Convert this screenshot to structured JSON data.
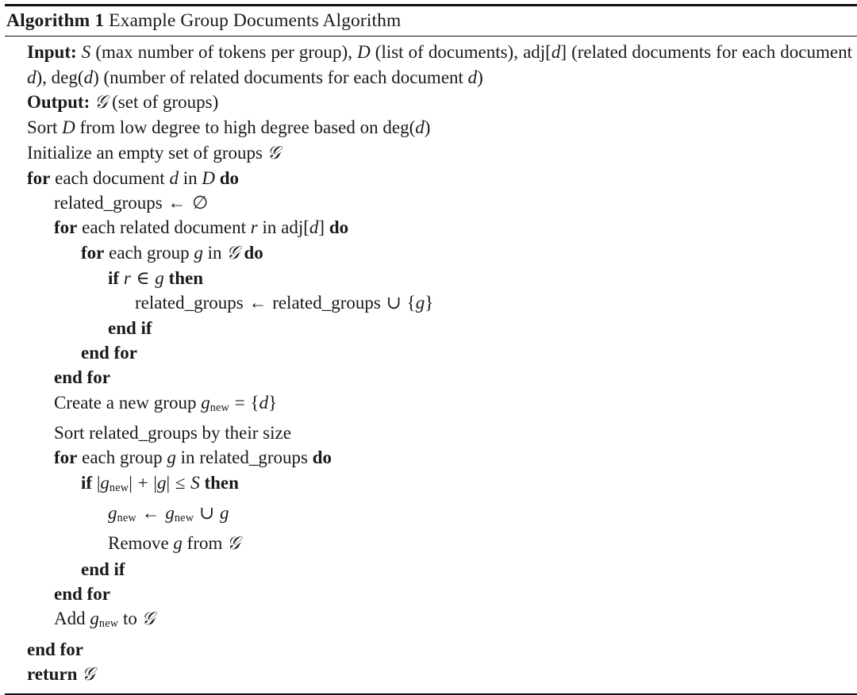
{
  "document": {
    "type": "algorithm-float",
    "caption_keyword": "Algorithm",
    "caption_number": "1",
    "caption_title": "Example Group Documents Algorithm",
    "rules": {
      "top": "thick",
      "under_caption": "thin",
      "bottom": "thin"
    },
    "colors": {
      "text": "#1a1a1a",
      "rule": "#111111",
      "background": "#ffffff"
    }
  },
  "lines": [
    {
      "id": "input",
      "indent": 0,
      "label": "Input:",
      "text": "S (max number of tokens per group), D (list of documents), adj[d] (related documents for each document d), deg(d) (number of related documents for each document d)"
    },
    {
      "id": "output",
      "indent": 0,
      "label": "Output:",
      "text": "G (set of groups)"
    },
    {
      "id": "sort-d",
      "indent": 0,
      "text": "Sort D from low degree to high degree based on deg(d)"
    },
    {
      "id": "init-groups",
      "indent": 0,
      "text": "Initialize an empty set of groups G"
    },
    {
      "id": "for-document",
      "indent": 0,
      "text": "for each document d in D do"
    },
    {
      "id": "related-groups-empty",
      "indent": 1,
      "text": "related_groups ← ∅"
    },
    {
      "id": "for-related-document",
      "indent": 1,
      "text": "for each related document r in adj[d] do"
    },
    {
      "id": "for-group-in-G",
      "indent": 2,
      "text": "for each group g in G do"
    },
    {
      "id": "if-r-in-g",
      "indent": 3,
      "text": "if r ∈ g then"
    },
    {
      "id": "related-groups-union",
      "indent": 4,
      "text": "related_groups ← related_groups ∪ {g}"
    },
    {
      "id": "end-if-1",
      "indent": 3,
      "text": "end if"
    },
    {
      "id": "end-for-group",
      "indent": 2,
      "text": "end for"
    },
    {
      "id": "end-for-related-document",
      "indent": 1,
      "text": "end for"
    },
    {
      "id": "create-new-group",
      "indent": 1,
      "text": "Create a new group g_new = {d}"
    },
    {
      "id": "sort-related-groups",
      "indent": 1,
      "text": "Sort related_groups by their size"
    },
    {
      "id": "for-group-in-related",
      "indent": 1,
      "text": "for each group g in related_groups do"
    },
    {
      "id": "if-size-leq-S",
      "indent": 2,
      "text": "if |g_new| + |g| ≤ S then"
    },
    {
      "id": "merge-gnew",
      "indent": 3,
      "text": "g_new ← g_new ∪ g"
    },
    {
      "id": "remove-g",
      "indent": 3,
      "text": "Remove g from G"
    },
    {
      "id": "end-if-2",
      "indent": 2,
      "text": "end if"
    },
    {
      "id": "end-for-related-groups",
      "indent": 1,
      "text": "end for"
    },
    {
      "id": "add-gnew",
      "indent": 1,
      "text": "Add g_new to G"
    },
    {
      "id": "end-for-document",
      "indent": 0,
      "text": "end for"
    },
    {
      "id": "return-G",
      "indent": 0,
      "text": "return G"
    }
  ],
  "tokens": {
    "input_label": "Input:",
    "output_label": "Output:",
    "kw_for": "for",
    "kw_do": "do",
    "kw_if": "if",
    "kw_then": "then",
    "kw_end_if": "end if",
    "kw_end_for": "end for",
    "kw_return": "return",
    "var_S": "S",
    "var_D": "D",
    "var_d": "d",
    "var_r": "r",
    "var_g": "g",
    "var_G": "𝒢",
    "sub_new": "new",
    "sym_gets": "←",
    "sym_emptyset": "∅",
    "sym_in": "∈",
    "sym_cup": "∪",
    "sym_leq": "≤",
    "sym_eq": "=",
    "sym_plus": "+",
    "ident_related_groups": "related_groups",
    "ident_adj": "adj",
    "ident_deg": "deg",
    "text_input_1": "(max number of tokens per group),",
    "text_input_2": "(list of documents),",
    "text_input_3": "(related documents for each document",
    "text_input_4": "(number of related documents for each document",
    "text_output": "(set of groups)",
    "text_sort_d_a": "Sort",
    "text_sort_d_b": "from low degree to high degree based on",
    "text_init": "Initialize an empty set of groups",
    "text_each_document": "each document",
    "text_in": "in",
    "text_each_related_document": "each related document",
    "text_each_group": "each group",
    "text_create": "Create a new group",
    "text_sort_related": "Sort related_groups by their size",
    "text_remove": "Remove",
    "text_from": "from",
    "text_add": "Add",
    "text_to": "to"
  }
}
